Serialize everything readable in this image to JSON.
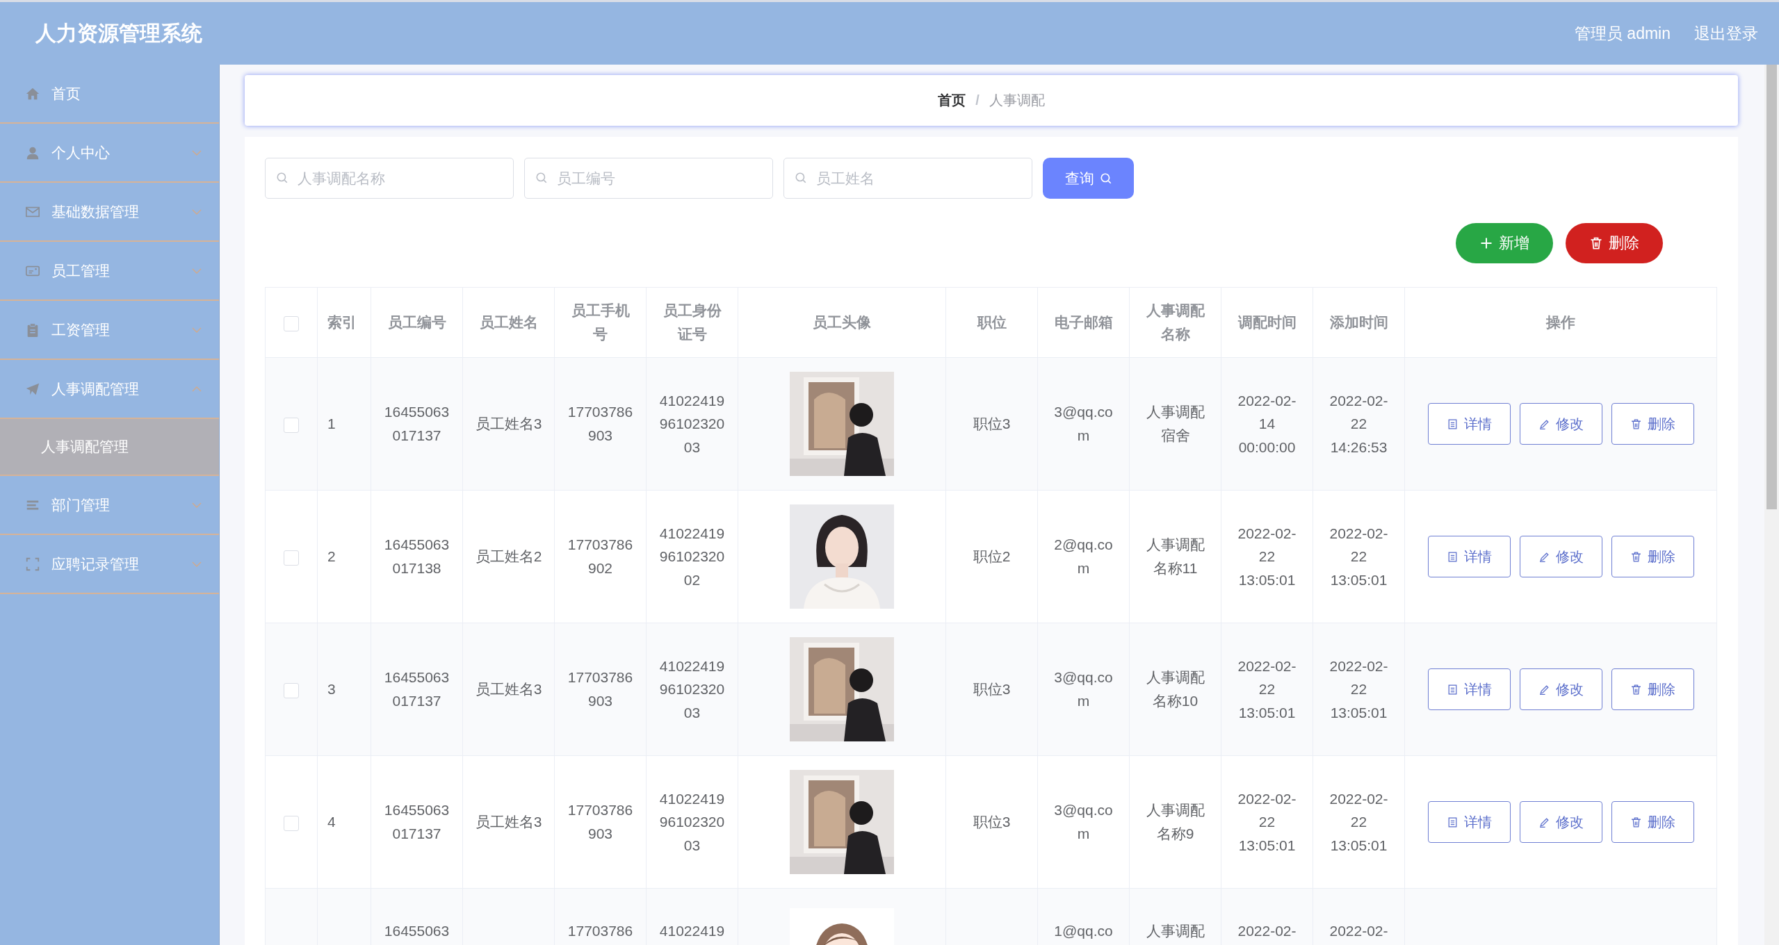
{
  "app_title": "人力资源管理系统",
  "header": {
    "user": "管理员 admin",
    "logout": "退出登录"
  },
  "sidebar": {
    "items": [
      {
        "label": "首页",
        "kind": "link"
      },
      {
        "label": "个人中心",
        "kind": "menu",
        "expanded": false
      },
      {
        "label": "基础数据管理",
        "kind": "menu",
        "expanded": false
      },
      {
        "label": "员工管理",
        "kind": "menu",
        "expanded": false
      },
      {
        "label": "工资管理",
        "kind": "menu",
        "expanded": false
      },
      {
        "label": "人事调配管理",
        "kind": "menu",
        "expanded": true,
        "children": [
          {
            "label": "人事调配管理",
            "selected": true
          }
        ]
      },
      {
        "label": "部门管理",
        "kind": "menu",
        "expanded": false
      },
      {
        "label": "应聘记录管理",
        "kind": "menu",
        "expanded": false
      }
    ]
  },
  "breadcrumb": {
    "items": [
      "首页",
      "人事调配"
    ],
    "separator": "/"
  },
  "search": {
    "fields": [
      {
        "placeholder": "人事调配名称"
      },
      {
        "placeholder": "员工编号"
      },
      {
        "placeholder": "员工姓名"
      }
    ],
    "button": "查询"
  },
  "actions": {
    "add": "新增",
    "delete": "删除"
  },
  "table": {
    "all_selected": false,
    "columns": [
      "索引",
      "员工编号",
      "员工姓名",
      "员工手机号",
      "员工身份证号",
      "员工头像",
      "职位",
      "电子邮箱",
      "人事调配名称",
      "调配时间",
      "添加时间",
      "操作"
    ],
    "rows": [
      {
        "selected": false,
        "index": "1",
        "emp_no": "16455063017137",
        "name": "员工姓名3",
        "phone": "17703786903",
        "id_card": "410224199610232003",
        "position": "职位3",
        "email": "3@qq.com",
        "transfer_name": "人事调配宿舍",
        "transfer_time": "2022-02-14 00:00:00",
        "added_time": "2022-02-22 14:26:53",
        "actions": [
          "详情",
          "修改",
          "删除"
        ]
      },
      {
        "selected": false,
        "index": "2",
        "emp_no": "16455063017138",
        "name": "员工姓名2",
        "phone": "17703786902",
        "id_card": "410224199610232002",
        "position": "职位2",
        "email": "2@qq.com",
        "transfer_name": "人事调配名称11",
        "transfer_time": "2022-02-22 13:05:01",
        "added_time": "2022-02-22 13:05:01",
        "actions": [
          "详情",
          "修改",
          "删除"
        ]
      },
      {
        "selected": false,
        "index": "3",
        "emp_no": "16455063017137",
        "name": "员工姓名3",
        "phone": "17703786903",
        "id_card": "410224199610232003",
        "position": "职位3",
        "email": "3@qq.com",
        "transfer_name": "人事调配名称10",
        "transfer_time": "2022-02-22 13:05:01",
        "added_time": "2022-02-22 13:05:01",
        "actions": [
          "详情",
          "修改",
          "删除"
        ]
      },
      {
        "selected": false,
        "index": "4",
        "emp_no": "16455063017137",
        "name": "员工姓名3",
        "phone": "17703786903",
        "id_card": "410224199610232003",
        "position": "职位3",
        "email": "3@qq.com",
        "transfer_name": "人事调配名称9",
        "transfer_time": "2022-02-22 13:05:01",
        "added_time": "2022-02-22 13:05:01",
        "actions": [
          "详情",
          "修改",
          "删除"
        ]
      },
      {
        "emp_no": "16455063",
        "phone": "17703786",
        "id_card": "41022419",
        "email": "1@qq.co",
        "transfer_name": "人事调配",
        "transfer_time": "2022-02-",
        "added_time": "2022-02-"
      }
    ]
  }
}
